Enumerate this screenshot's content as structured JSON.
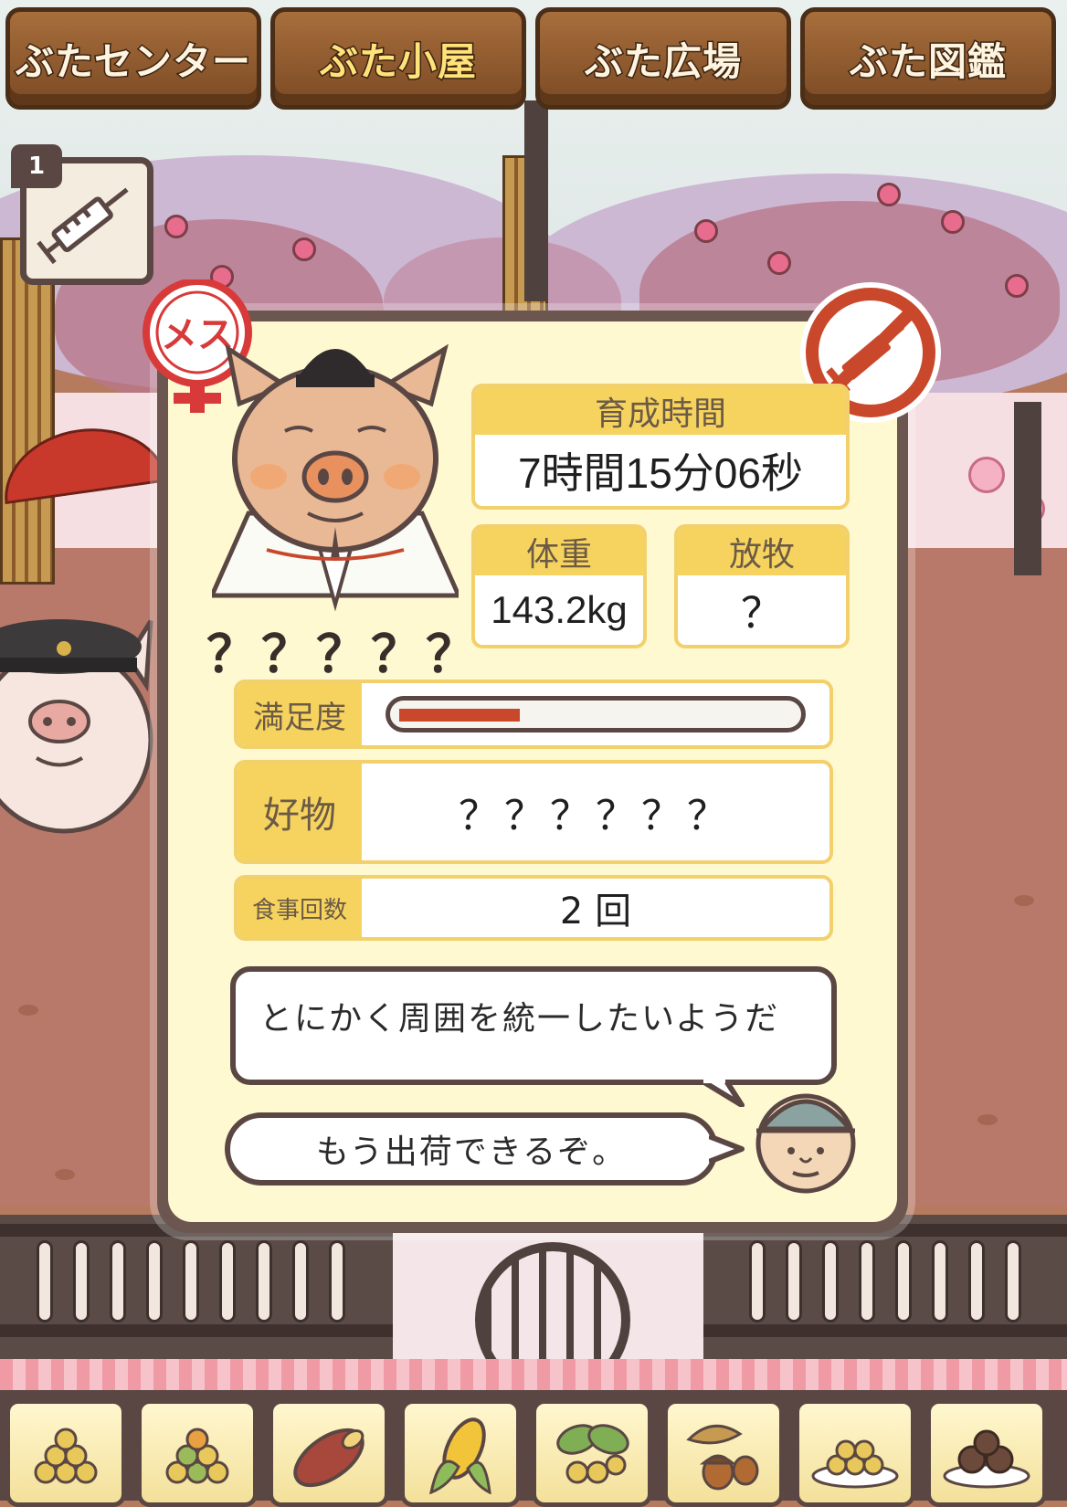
{
  "tabs": [
    {
      "label": "ぶたセンター",
      "active": false
    },
    {
      "label": "ぶた小屋",
      "active": true
    },
    {
      "label": "ぶた広場",
      "active": false
    },
    {
      "label": "ぶた図鑑",
      "active": false
    }
  ],
  "item_slot": {
    "count": "1",
    "icon": "syringe-icon"
  },
  "pig": {
    "gender_label": "メス",
    "name": "？？？？？",
    "injection_status_icon": "no-syringe-icon"
  },
  "stats": {
    "growth_time": {
      "label": "育成時間",
      "value": "7時間15分06秒"
    },
    "weight": {
      "label": "体重",
      "value": "143.2kg"
    },
    "grazing": {
      "label": "放牧",
      "value": "？"
    }
  },
  "satisfaction": {
    "label": "満足度",
    "level": 0.3
  },
  "favorite_food": {
    "label": "好物",
    "value": "？？？？？？"
  },
  "meal_count": {
    "label": "食事回数",
    "value": "2 回"
  },
  "comment": "とにかく周囲を統一したいようだ",
  "farmer_message": "もう出荷できるぞ。",
  "food_bar": [
    {
      "icon": "soybeans-icon"
    },
    {
      "icon": "mixed-grain-icon"
    },
    {
      "icon": "sweet-potato-icon"
    },
    {
      "icon": "corn-icon"
    },
    {
      "icon": "herb-nuts-icon"
    },
    {
      "icon": "acorn-icon"
    },
    {
      "icon": "grain-plate-icon"
    },
    {
      "icon": "truffle-plate-icon"
    }
  ],
  "colors": {
    "tab_wood": "#8b5a2b",
    "panel_border": "#6b574f",
    "panel_bg": "#fff9d1",
    "label_yellow": "#f6d35e",
    "meter_fill": "#c9482b",
    "female_red": "#d83a3a"
  }
}
